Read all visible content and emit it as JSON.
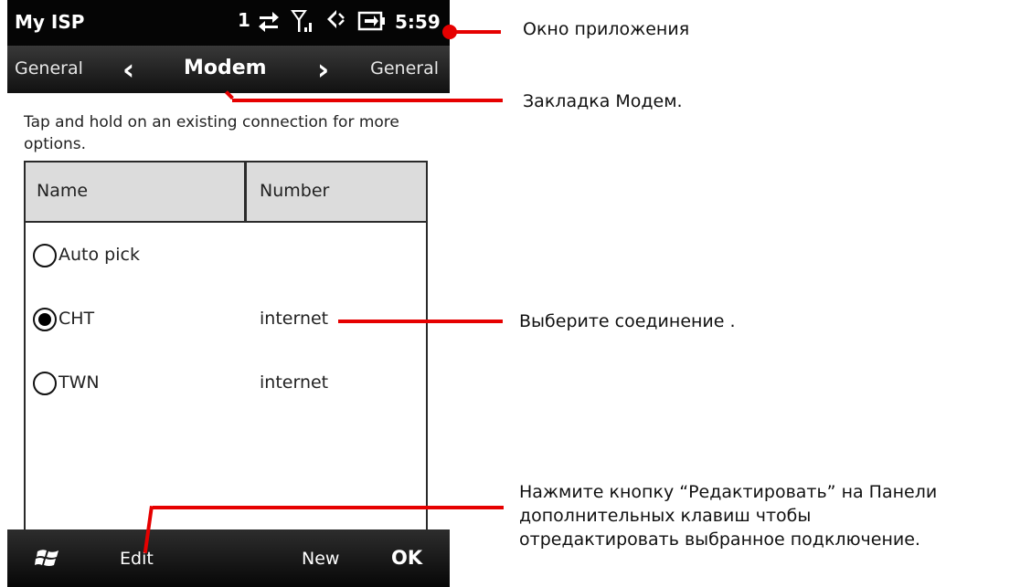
{
  "status_bar": {
    "app_title": "My ISP",
    "indicator": "1",
    "time": "5:59",
    "icons": [
      "data-transfer-icon",
      "signal-icon",
      "speaker-muted-icon",
      "battery-charging-icon"
    ]
  },
  "tabs": {
    "prev": "General",
    "current": "Modem",
    "next": "General"
  },
  "hint": "Tap and hold on an existing connection for more options.",
  "table": {
    "columns": [
      "Name",
      "Number"
    ],
    "rows": [
      {
        "name": "Auto pick",
        "number": "",
        "selected": false
      },
      {
        "name": "CHT",
        "number": "internet",
        "selected": true
      },
      {
        "name": "TWN",
        "number": "internet",
        "selected": false
      }
    ]
  },
  "softkeys": {
    "start_icon": "windows-flag-icon",
    "edit": "Edit",
    "new": "New",
    "ok": "OK"
  },
  "annotations": {
    "app_window": "Окно приложения",
    "modem_tab": "Закладка Модем.",
    "select_connection": "Выберите соединение .",
    "edit_line1": "Нажмите кнопку “Редактировать” на Панели",
    "edit_line2": "дополнительных клавиш чтобы",
    "edit_line3": "отредактировать выбранное подключение."
  },
  "colors": {
    "annotation_red": "#e60000",
    "bar_black": "#050505",
    "header_gray": "#dcdcdc"
  }
}
